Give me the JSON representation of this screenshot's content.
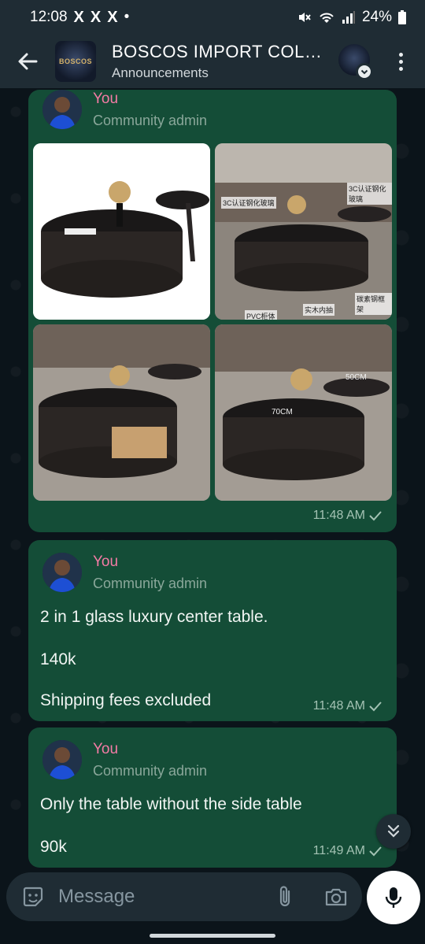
{
  "status_bar": {
    "time": "12:08",
    "notification_icons": [
      "X",
      "X",
      "X"
    ],
    "dot": "•",
    "battery": "24%"
  },
  "header": {
    "title": "BOSCOS IMPORT COLL...",
    "subtitle": "Announcements",
    "logo_text": "BOSCOS"
  },
  "messages": [
    {
      "sender": "You",
      "role": "Community admin",
      "photos": [
        {
          "icon": "coffee-table-photo"
        },
        {
          "icon": "coffee-table-photo"
        },
        {
          "icon": "coffee-table-photo"
        },
        {
          "icon": "coffee-table-photo"
        }
      ],
      "photo_labels": [
        "3C认证钢化玻璃",
        "3C认证钢化玻璃",
        "碳素钢框架",
        "实木内抽",
        "PVC柜体",
        "50CM",
        "70CM"
      ],
      "time": "11:48 AM"
    },
    {
      "sender": "You",
      "role": "Community admin",
      "lines": [
        "2 in 1 glass luxury center table.",
        "140k",
        "Shipping fees excluded"
      ],
      "time": "11:48 AM"
    },
    {
      "sender": "You",
      "role": "Community admin",
      "lines": [
        "Only the table without the side table",
        "90k"
      ],
      "time": "11:49 AM"
    }
  ],
  "input": {
    "placeholder": "Message"
  },
  "colors": {
    "bubble": "#144d37",
    "background": "#0b141a",
    "bar": "#1f2c34",
    "sender_name": "#f47ba5",
    "meta": "#8aa79a"
  }
}
